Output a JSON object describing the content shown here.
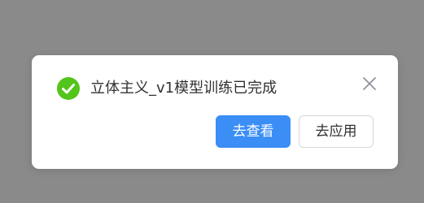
{
  "dialog": {
    "message": "立体主义_v1模型训练已完成",
    "status_icon": "success-check-icon",
    "close_icon": "close-icon",
    "buttons": {
      "view_label": "去查看",
      "apply_label": "去应用"
    }
  },
  "colors": {
    "overlay": "#8a8a8a",
    "success": "#52c41a",
    "primary": "#3a8ef6",
    "text": "#303133",
    "close_icon": "#909399"
  }
}
